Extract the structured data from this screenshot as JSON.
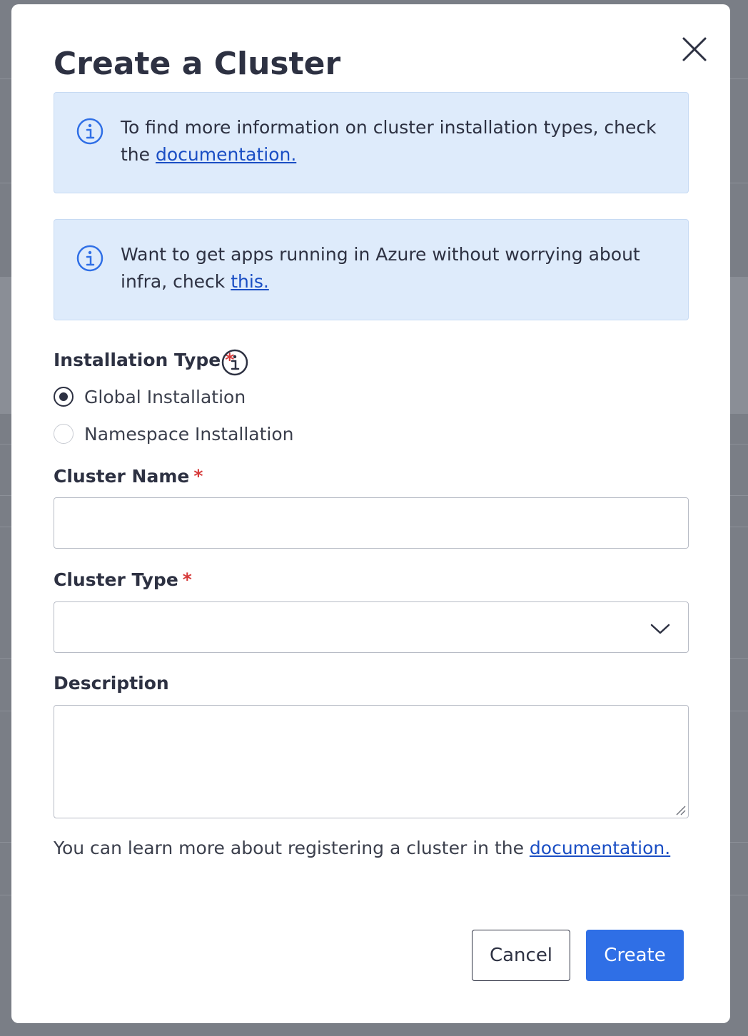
{
  "modal": {
    "title": "Create a Cluster",
    "close_icon": "close-icon"
  },
  "banners": [
    {
      "icon": "info-icon",
      "text": "To find more information on cluster installation types, check the ",
      "link": "documentation."
    },
    {
      "icon": "info-icon",
      "text": "Want to get apps running in Azure without worrying about infra, check ",
      "link": "this."
    }
  ],
  "installation_type": {
    "label": "Installation Type",
    "required_mark": "*",
    "info_icon": "info-icon",
    "options": [
      {
        "label": "Global Installation",
        "checked": true
      },
      {
        "label": "Namespace Installation",
        "checked": false
      }
    ]
  },
  "cluster_name": {
    "label": "Cluster Name",
    "required_mark": "*",
    "value": "",
    "placeholder": ""
  },
  "cluster_type": {
    "label": "Cluster Type",
    "required_mark": "*",
    "selected": "",
    "chevron_icon": "chevron-down-icon"
  },
  "description": {
    "label": "Description",
    "value": ""
  },
  "footnote": {
    "text": "You can learn more about registering a cluster in the ",
    "link": "documentation."
  },
  "buttons": {
    "cancel": "Cancel",
    "create": "Create"
  },
  "colors": {
    "primary": "#2f6fe6",
    "banner_bg": "#deebfb",
    "link": "#1a4ec4",
    "required": "#d63a3a",
    "text": "#2d3142"
  }
}
